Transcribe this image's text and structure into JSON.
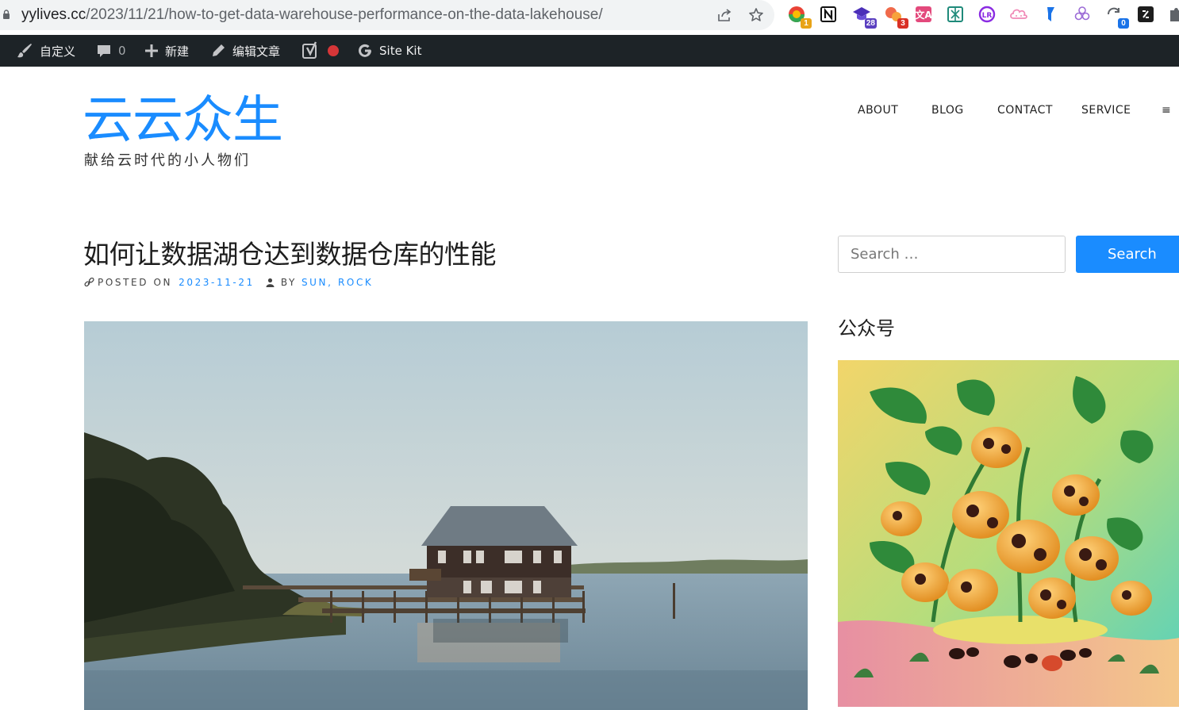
{
  "browser": {
    "url_host": "yylives.cc",
    "url_path": "/2023/11/21/how-to-get-data-warehouse-performance-on-the-data-lakehouse/",
    "icons": [
      "lock-icon",
      "share-icon",
      "bookmark-star-icon"
    ],
    "extensions": [
      {
        "name": "extension-chrome-colors-icon",
        "badge": "1",
        "badge_color": "#e8a317"
      },
      {
        "name": "extension-notion-icon",
        "badge": ""
      },
      {
        "name": "extension-graduation-cap-icon",
        "badge": "28",
        "badge_color": "#5a3fc0"
      },
      {
        "name": "extension-bubbles-icon",
        "badge": "3",
        "badge_color": "#d93025"
      },
      {
        "name": "extension-translate-icon",
        "badge": ""
      },
      {
        "name": "extension-grid-icon",
        "badge": ""
      },
      {
        "name": "extension-lr-icon",
        "badge": ""
      },
      {
        "name": "extension-cloud-icon",
        "badge": ""
      },
      {
        "name": "extension-flag-icon",
        "badge": ""
      },
      {
        "name": "extension-openai-icon",
        "badge": ""
      },
      {
        "name": "extension-sync-icon",
        "badge": "0",
        "badge_color": "#1a73e8"
      },
      {
        "name": "extension-dark-box-icon",
        "badge": ""
      },
      {
        "name": "extensions-puzzle-icon",
        "badge": ""
      }
    ]
  },
  "adminbar": {
    "customize": "自定义",
    "comments_count": "0",
    "new": "新建",
    "edit_post": "编辑文章",
    "site_kit": "Site Kit",
    "status_color": "#d63638"
  },
  "site": {
    "title": "云云众生",
    "description": "献给云时代的小人物们",
    "accent": "#1a8cff"
  },
  "nav": {
    "items": [
      "ABOUT",
      "BLOG",
      "CONTACT",
      "SERVICE"
    ],
    "menu_glyph": "≡"
  },
  "post": {
    "title": "如何让数据湖仓达到数据仓库的性能",
    "posted_on_label": "POSTED ON",
    "date": "2023-11-21",
    "by_label": "BY",
    "author": "SUN, ROCK"
  },
  "sidebar": {
    "search_placeholder": "Search …",
    "search_button": "Search",
    "widget_title": "公众号"
  }
}
